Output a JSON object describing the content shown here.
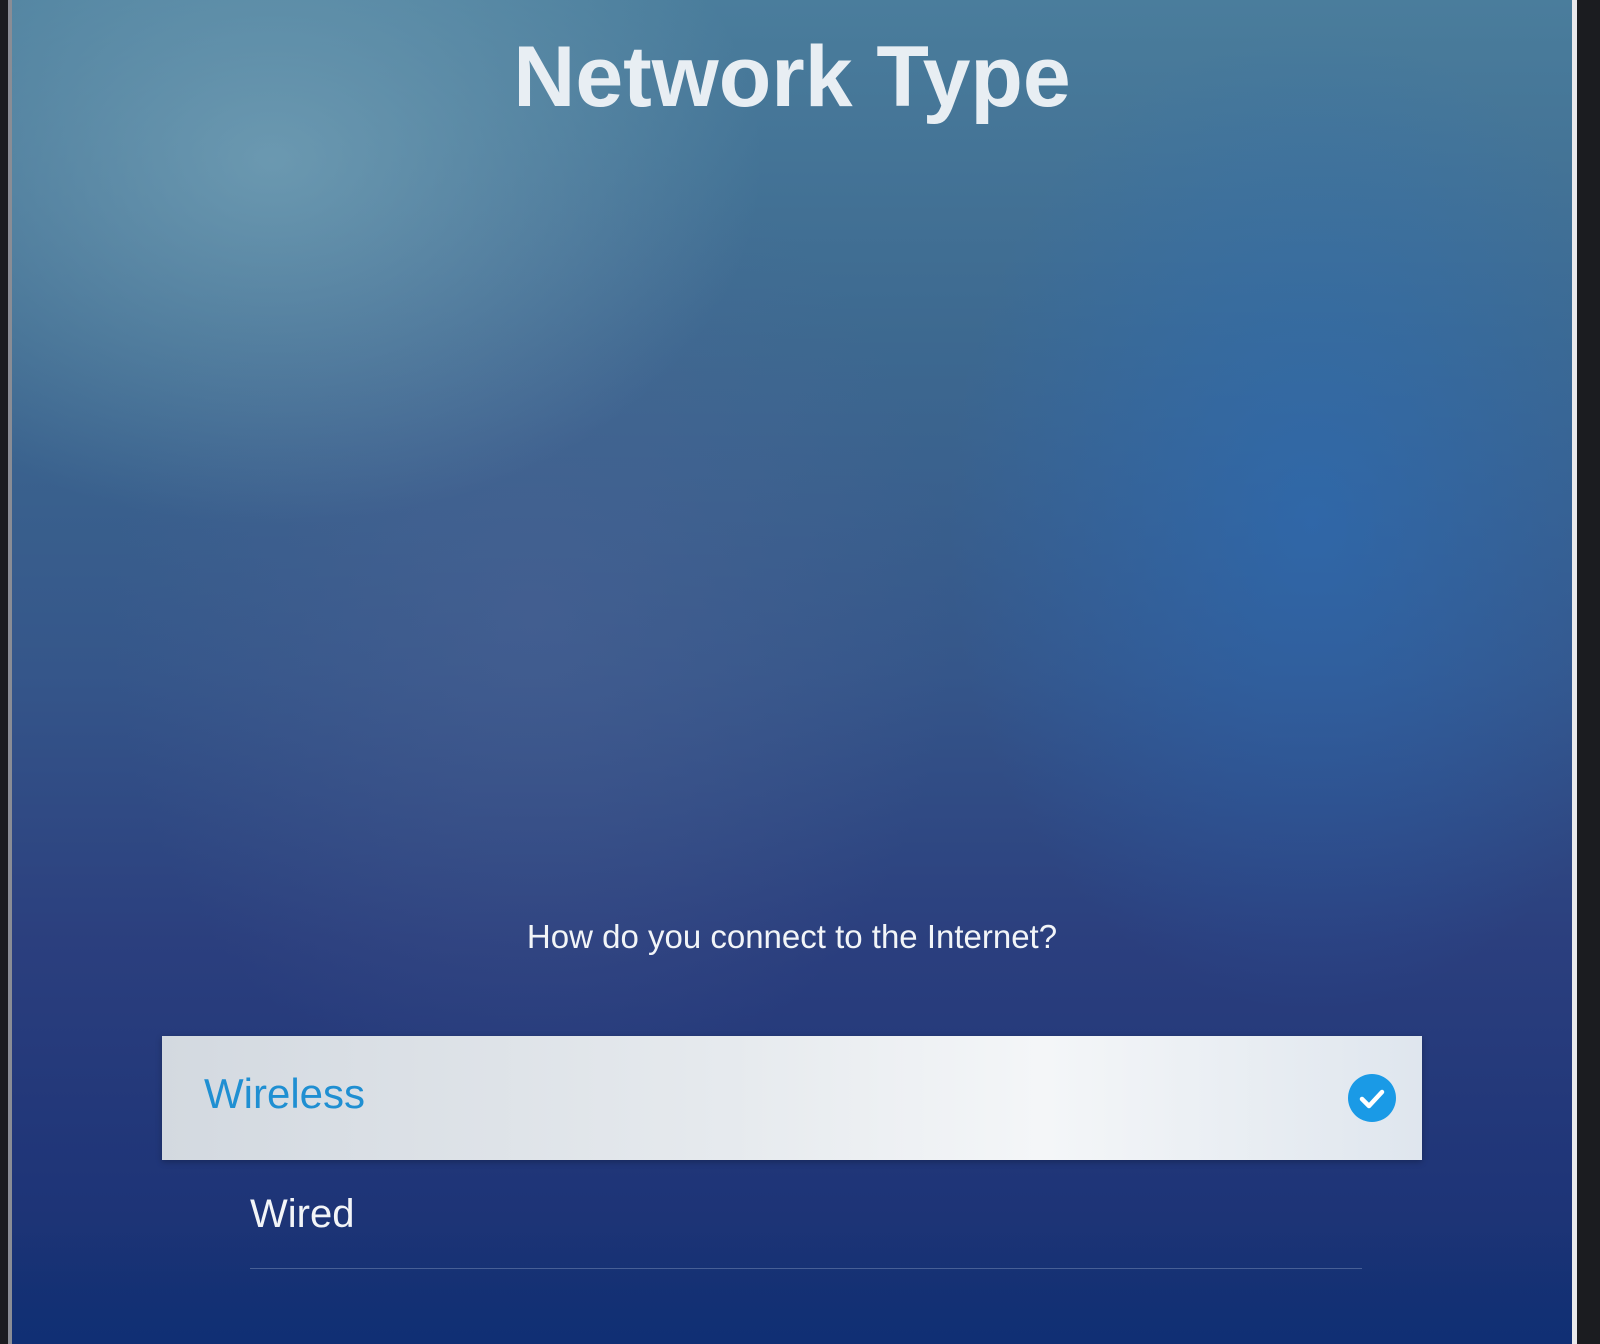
{
  "screen": {
    "title": "Network Type",
    "question": "How do you connect to the Internet?"
  },
  "options": [
    {
      "label": "Wireless",
      "selected": true,
      "icon": "check-circle-icon"
    },
    {
      "label": "Wired",
      "selected": false
    }
  ],
  "colors": {
    "accent": "#1a9ae6",
    "selected_text": "#1f8fd2",
    "title_text": "#e8eef3"
  }
}
